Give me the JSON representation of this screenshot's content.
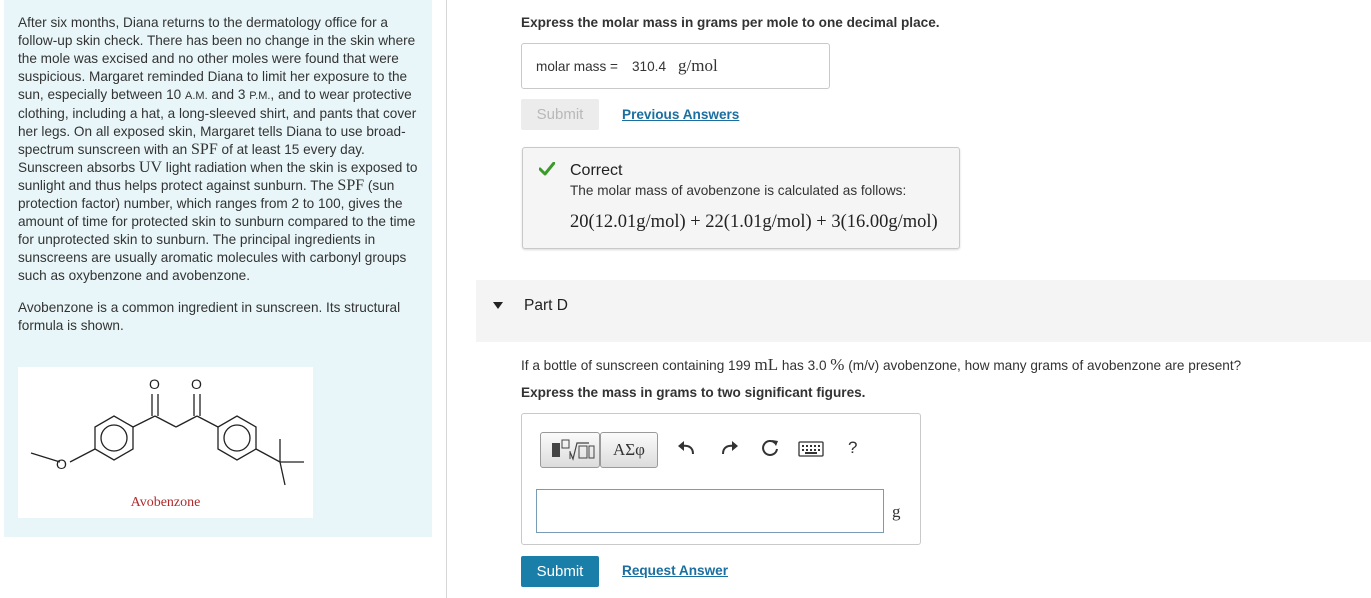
{
  "passage": {
    "p1_a": "After six months, Diana returns to the dermatology office for a follow-up skin check. There has been no change in the skin where the mole was excised and no other moles were found that were suspicious. Margaret reminded Diana to limit her exposure to the sun, especially between 10 ",
    "am": "A.M.",
    "p1_b": " and 3 ",
    "pm": "P.M.",
    "p1_c": ", and to wear protective clothing, including a hat, a long-sleeved shirt, and pants that cover her legs. On all exposed skin, Margaret tells Diana to use broad-spectrum sunscreen with an ",
    "spf1": "SPF",
    "p1_d": " of at least 15 every day. Sunscreen absorbs ",
    "uv": "UV",
    "p1_e": " light radiation when the skin is exposed to sunlight and thus helps protect against sunburn. The ",
    "spf2": "SPF",
    "p1_f": " (sun protection factor) number, which ranges from 2 to 100, gives the amount of time for protected skin to sunburn compared to the time for unprotected skin to sunburn. The principal ingredients in sunscreens are usually aromatic molecules with carbonyl groups such as oxybenzone and avobenzone.",
    "p2": "Avobenzone is a common ingredient in sunscreen. Its structural formula is shown.",
    "caption": "Avobenzone",
    "atom_o1": "O",
    "atom_o2": "O",
    "atom_o3": "O"
  },
  "partC": {
    "instruction": "Express the molar mass in grams per mole to one decimal place.",
    "answer_label": "molar mass =",
    "answer_value": "310.4",
    "answer_unit": "g/mol",
    "submit_label": "Submit",
    "previous_answers": "Previous Answers",
    "feedback_title": "Correct",
    "feedback_msg": "The molar mass of avobenzone is calculated as follows:",
    "feedback_eq": "20(12.01g/mol) + 22(1.01g/mol) + 3(16.00g/mol)"
  },
  "partD": {
    "label": "Part D",
    "q_a": "If a bottle of sunscreen containing 199 ",
    "q_unit1": "mL",
    "q_b": " has 3.0 ",
    "q_pct": "%",
    "q_c": " (m/v) avobenzone, how many grams of avobenzone are present?",
    "instruction": "Express the mass in grams to two significant figures.",
    "symbols_label": "ΑΣφ",
    "help_label": "?",
    "input_value": "",
    "input_unit": "g",
    "submit_label": "Submit",
    "request_answer": "Request Answer"
  },
  "colors": {
    "panel_bg": "#e8f6f9",
    "link": "#1a6fa0",
    "submit_active": "#1a7fa8",
    "correct_check": "#3a9a2a",
    "caption": "#b02a2a"
  },
  "icons": [
    "checkmark-icon",
    "collapse-triangle-icon",
    "templates-icon",
    "undo-icon",
    "redo-icon",
    "reset-icon",
    "keyboard-icon"
  ]
}
